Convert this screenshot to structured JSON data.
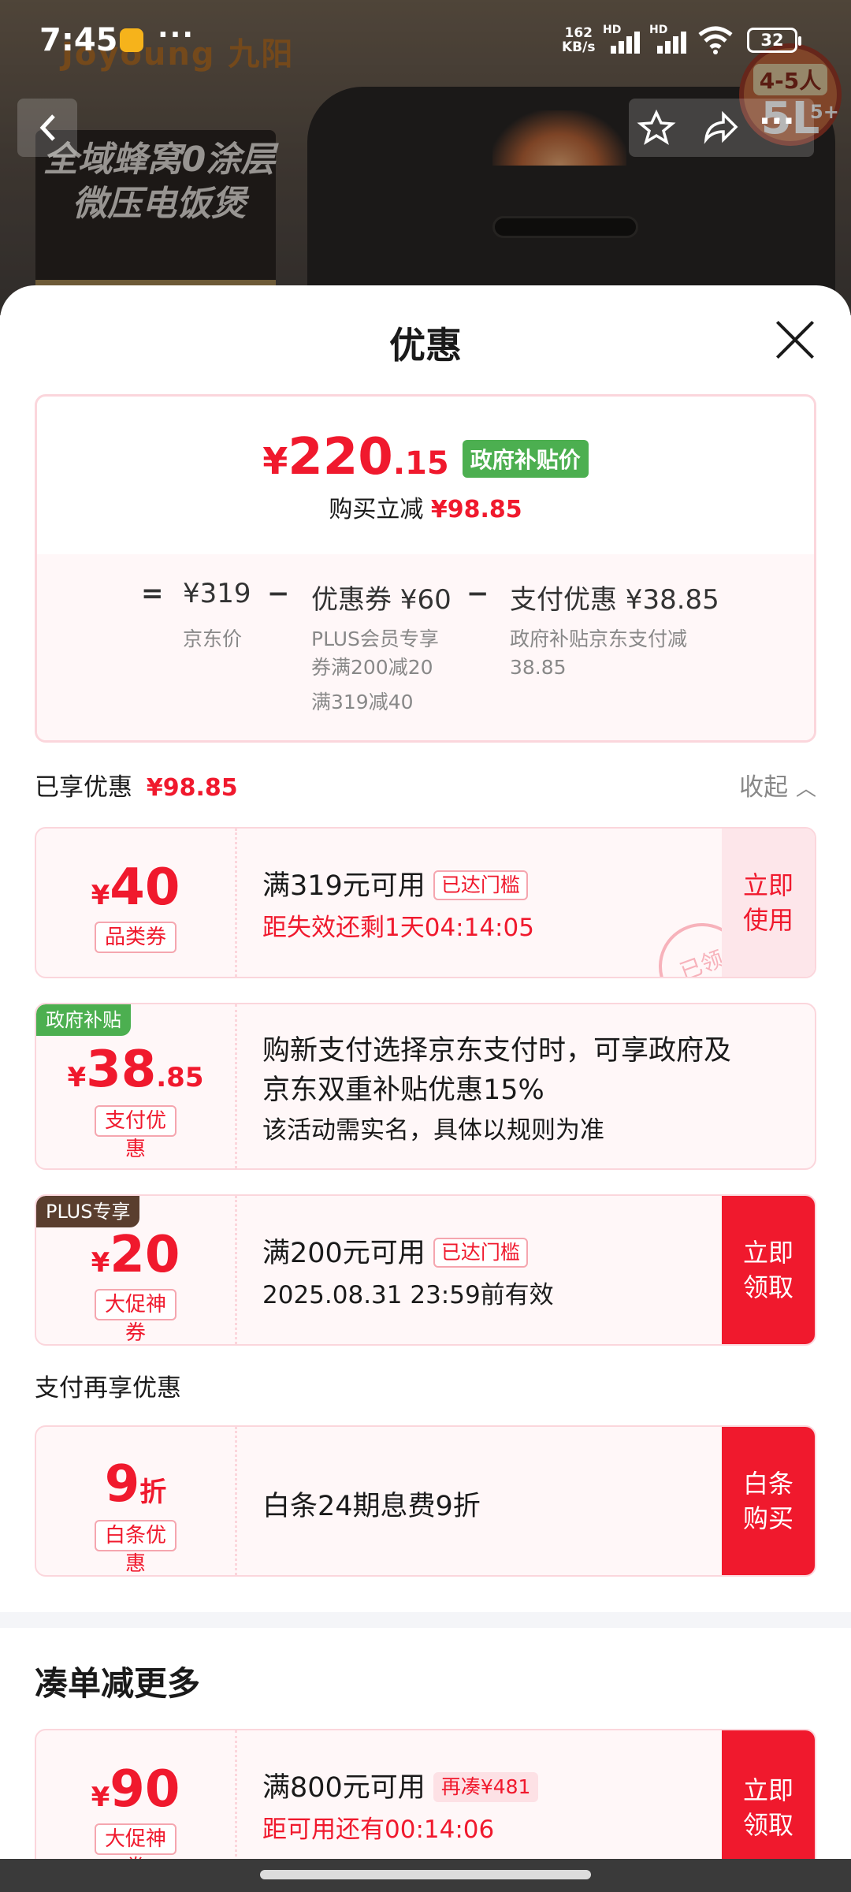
{
  "status_bar": {
    "time": "7:45",
    "speed_top": "162",
    "speed_bottom": "KB/s",
    "sim1": "HD",
    "sim2": "HD",
    "battery": "32"
  },
  "background": {
    "brand": "Joyoung 九阳",
    "poster_title_line1": "全域蜂窝0涂层",
    "poster_title_line2": "微压电饭煲",
    "badge_top": "4-5人",
    "badge_big": "5L",
    "badge_suffix": "5+"
  },
  "nav": {
    "back_icon": "chevron-left-icon",
    "star_icon": "star-icon",
    "share_icon": "share-icon",
    "more_icon": "more-icon"
  },
  "sheet": {
    "title": "优惠"
  },
  "summary": {
    "price_symbol": "¥",
    "price_int": "220",
    "price_dec": ".15",
    "price_tag": "政府补贴价",
    "save_label": "购买立减",
    "save_amount": "¥98.85",
    "eq": "=",
    "base_price": "¥319",
    "minus1": "−",
    "coupon": "优惠券 ¥60",
    "minus2": "−",
    "pay_discount": "支付优惠 ¥38.85",
    "base_sub": "京东价",
    "coupon_sub_1": "PLUS会员专享",
    "coupon_sub_2": "券满200减20",
    "coupon_sub_3": "满319减40",
    "pay_sub_1": "政府补贴京东支付减",
    "pay_sub_2": "38.85"
  },
  "enjoyed": {
    "label": "已享优惠",
    "amount": "¥98.85",
    "collapse": "收起"
  },
  "cards": [
    {
      "sym": "¥",
      "value": "40",
      "decimal": "",
      "type": "品类券",
      "title": "满319元可用",
      "tag": "已达门槛",
      "sub": "距失效还剩1天04:14:05",
      "action": "立即\n使用",
      "stamp": "已领"
    },
    {
      "corner": "政府补贴",
      "sym": "¥",
      "value": "38",
      "decimal": ".85",
      "type": "支付优惠",
      "title": "购新支付选择京东支付时，可享政府及",
      "title2": "京东双重补贴优惠15%",
      "sub": "该活动需实名，具体以规则为准"
    },
    {
      "corner": "PLUS专享",
      "sym": "¥",
      "value": "20",
      "decimal": "",
      "type": "大促神券",
      "title": "满200元可用",
      "tag": "已达门槛",
      "sub": "2025.08.31 23:59前有效",
      "action": "立即\n领取"
    }
  ],
  "pay_more": {
    "label": "支付再享优惠"
  },
  "baitiao": {
    "value": "9",
    "unit": "折",
    "type": "白条优惠",
    "title": "白条24期息费9折",
    "action": "白条\n购买"
  },
  "more": {
    "title": "凑单减更多"
  },
  "more_card": {
    "sym": "¥",
    "value": "90",
    "type": "大促神券",
    "title": "满800元可用",
    "tag": "再凑¥481",
    "sub": "距可用还有00:14:06",
    "action": "立即\n领取"
  },
  "colors": {
    "accent": "#f0192d",
    "gov_green": "#4caf50",
    "plus_brown": "#5a3e2e",
    "card_bg": "#fff7f8"
  }
}
